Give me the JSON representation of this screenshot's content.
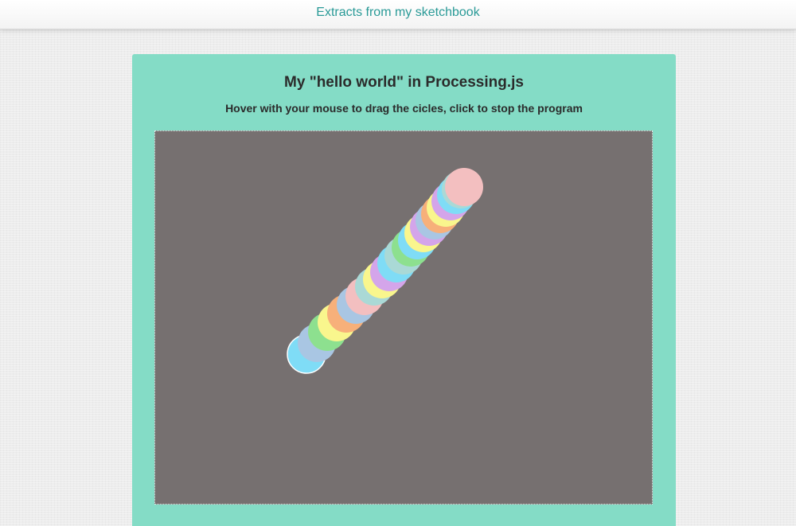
{
  "header": {
    "link_label": "Extracts from my sketchbook"
  },
  "card": {
    "title": "My \"hello world\" in Processing.js",
    "subtitle": "Hover with your mouse to drag the cicles, click to stop the program"
  },
  "sketch": {
    "background": "#767070",
    "circle_outline": "#ffffff",
    "circle_colors": [
      "#f3bfc0",
      "#8de08f",
      "#a9c6e3",
      "#d4a5ea",
      "#f9f68d",
      "#7fdcf6",
      "#f7b07a",
      "#aad9d6"
    ]
  }
}
